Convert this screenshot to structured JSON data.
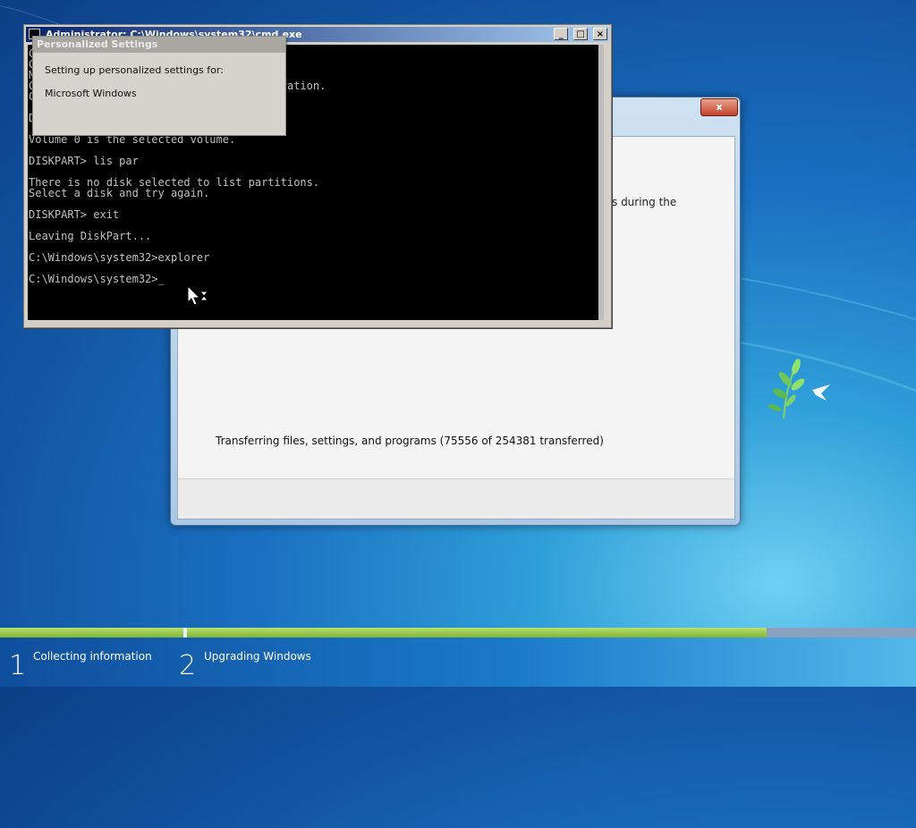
{
  "colors": {
    "desktop_bg": "#1a6fc0",
    "console_bg": "#000000",
    "console_text": "#c0c0c0",
    "progress_green": "#7fb537"
  },
  "setup_window": {
    "close_label": "x",
    "partial_text": "s during the",
    "progress_text": "Transferring files, settings, and programs (75556 of 254381 transferred)"
  },
  "cmd_window": {
    "title": "Administrator: C:\\Windows\\system32\\cmd.exe",
    "minimize_label": "_",
    "maximize_label": "□",
    "close_label": "×",
    "icon": "console-icon",
    "lines": [
      "C",
      "C",
      "M",
      "C                                  orporation.",
      "C",
      "",
      "DISKPART> sel vol 0",
      "",
      "Volume 0 is the selected volume.",
      "",
      "DISKPART> lis par",
      "",
      "There is no disk selected to list partitions.",
      "Select a disk and try again.",
      "",
      "DISKPART> exit",
      "",
      "Leaving DiskPart...",
      "",
      "C:\\Windows\\system32>explorer",
      "",
      "C:\\Windows\\system32>_"
    ]
  },
  "ps_dialog": {
    "title": "Personalized Settings",
    "line1": "Setting up personalized settings for:",
    "line2": "Microsoft Windows"
  },
  "progress": {
    "overall_fraction": 0.837
  },
  "steps": [
    {
      "number": "1",
      "label": "Collecting information"
    },
    {
      "number": "2",
      "label": "Upgrading Windows"
    }
  ],
  "icons": {
    "cursor": "busy-arrow-cursor-icon",
    "logo": "bird-leaves-logo-icon"
  }
}
